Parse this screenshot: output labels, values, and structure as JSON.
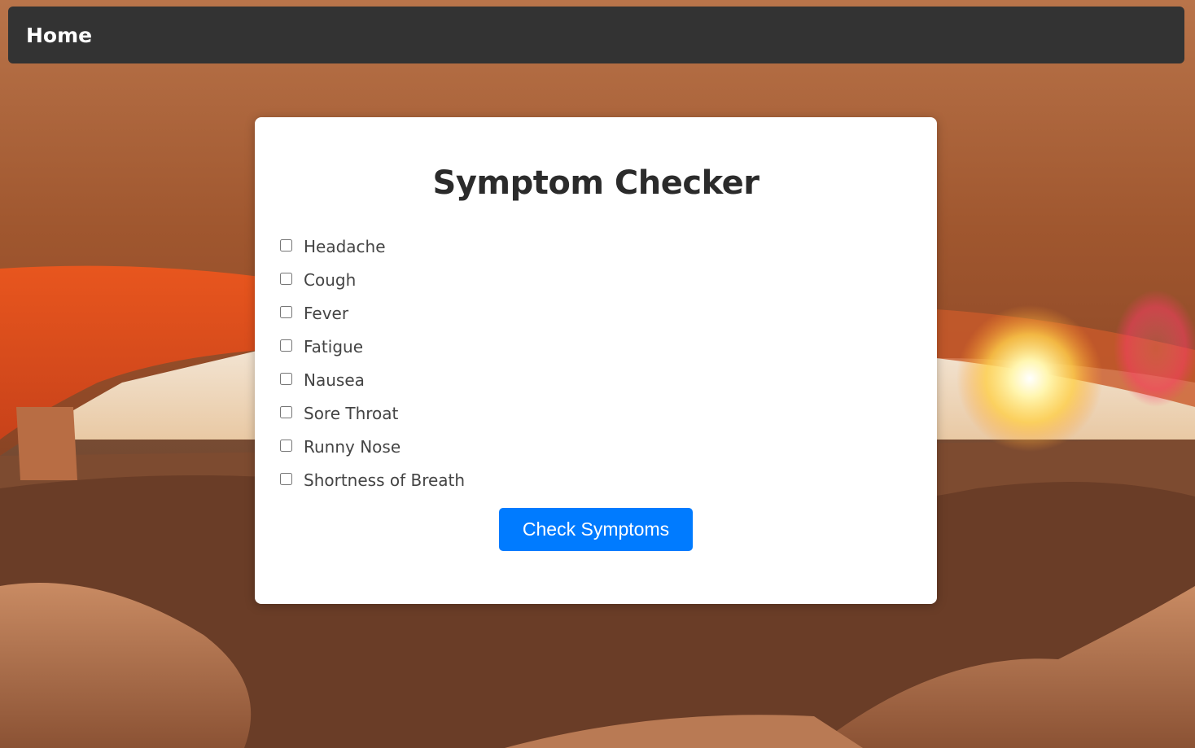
{
  "navbar": {
    "home_label": "Home"
  },
  "background": {
    "icon": "canyon-arch-sunset-photo"
  },
  "symptom_checker": {
    "title": "Symptom Checker",
    "symptoms": [
      {
        "label": "Headache",
        "checked": false
      },
      {
        "label": "Cough",
        "checked": false
      },
      {
        "label": "Fever",
        "checked": false
      },
      {
        "label": "Fatigue",
        "checked": false
      },
      {
        "label": "Nausea",
        "checked": false
      },
      {
        "label": "Sore Throat",
        "checked": false
      },
      {
        "label": "Runny Nose",
        "checked": false
      },
      {
        "label": "Shortness of Breath",
        "checked": false
      }
    ],
    "button_label": "Check Symptoms"
  },
  "colors": {
    "navbar": "#333333",
    "card": "#ffffff",
    "button": "#007bff",
    "title": "#2b2b2b"
  }
}
